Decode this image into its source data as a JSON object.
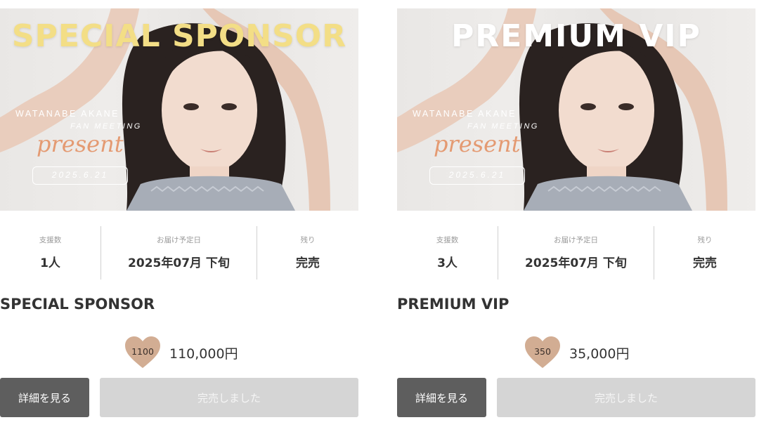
{
  "cards": [
    {
      "banner": {
        "title": "SPECIAL SPONSOR",
        "title_color": "#f3de86",
        "name": "WATANABE AKANE",
        "subtitle": "FAN MEETING",
        "script": "present",
        "date": "2025.6.21"
      },
      "stats": [
        {
          "label": "支援数",
          "value": "1人"
        },
        {
          "label": "お届け予定日",
          "value": "2025年07月 下旬"
        },
        {
          "label": "残り",
          "value": "完売"
        }
      ],
      "title": "SPECIAL SPONSOR",
      "heart_count": "1100",
      "price": "110,000円",
      "detail_label": "詳細を見る",
      "soldout_label": "完売しました"
    },
    {
      "banner": {
        "title": "PREMIUM  VIP",
        "title_color": "#ffffff",
        "name": "WATANABE AKANE",
        "subtitle": "FAN MEETING",
        "script": "present",
        "date": "2025.6.21"
      },
      "stats": [
        {
          "label": "支援数",
          "value": "3人"
        },
        {
          "label": "お届け予定日",
          "value": "2025年07月 下旬"
        },
        {
          "label": "残り",
          "value": "完売"
        }
      ],
      "title": "PREMIUM VIP",
      "heart_count": "350",
      "price": "35,000円",
      "detail_label": "詳細を見る",
      "soldout_label": "完売しました"
    }
  ],
  "colors": {
    "detail_button": "#5e5e5e",
    "soldout_button": "#d5d5d5",
    "heart": "#d2ad93",
    "accent_script": "#e49a72"
  }
}
